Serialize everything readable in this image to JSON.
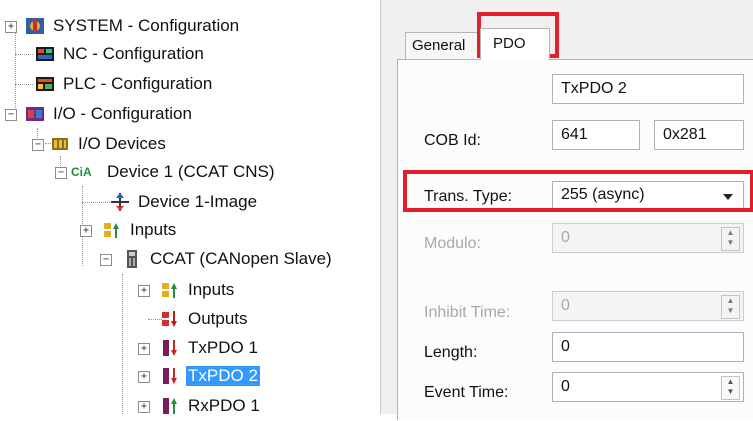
{
  "tree": {
    "system_config": "SYSTEM - Configuration",
    "nc_config": "NC - Configuration",
    "plc_config": "PLC - Configuration",
    "io_config": "I/O - Configuration",
    "io_devices": "I/O Devices",
    "device1": "Device 1 (CCAT CNS)",
    "device1_image": "Device 1-Image",
    "inputs": "Inputs",
    "ccat": "CCAT (CANopen Slave)",
    "ccat_inputs": "Inputs",
    "ccat_outputs": "Outputs",
    "txpdo1": "TxPDO 1",
    "txpdo2": "TxPDO 2",
    "rxpdo1": "RxPDO 1",
    "cia_label": "CiA",
    "expander_plus": "+",
    "expander_minus": "−"
  },
  "tabs": {
    "general": "General",
    "pdo": "PDO"
  },
  "pdo": {
    "name_value": "TxPDO 2",
    "cob_id_label": "COB Id:",
    "cob_id_dec": "641",
    "cob_id_hex": "0x281",
    "trans_type_label": "Trans. Type:",
    "trans_type_value": "255 (async)",
    "modulo_label": "Modulo:",
    "modulo_value": "0",
    "inhibit_label": "Inhibit Time:",
    "inhibit_value": "0",
    "length_label": "Length:",
    "length_value": "0",
    "event_label": "Event Time:",
    "event_value": "0"
  },
  "colors": {
    "selection": "#3399ff",
    "highlight_box": "#e0202a"
  }
}
